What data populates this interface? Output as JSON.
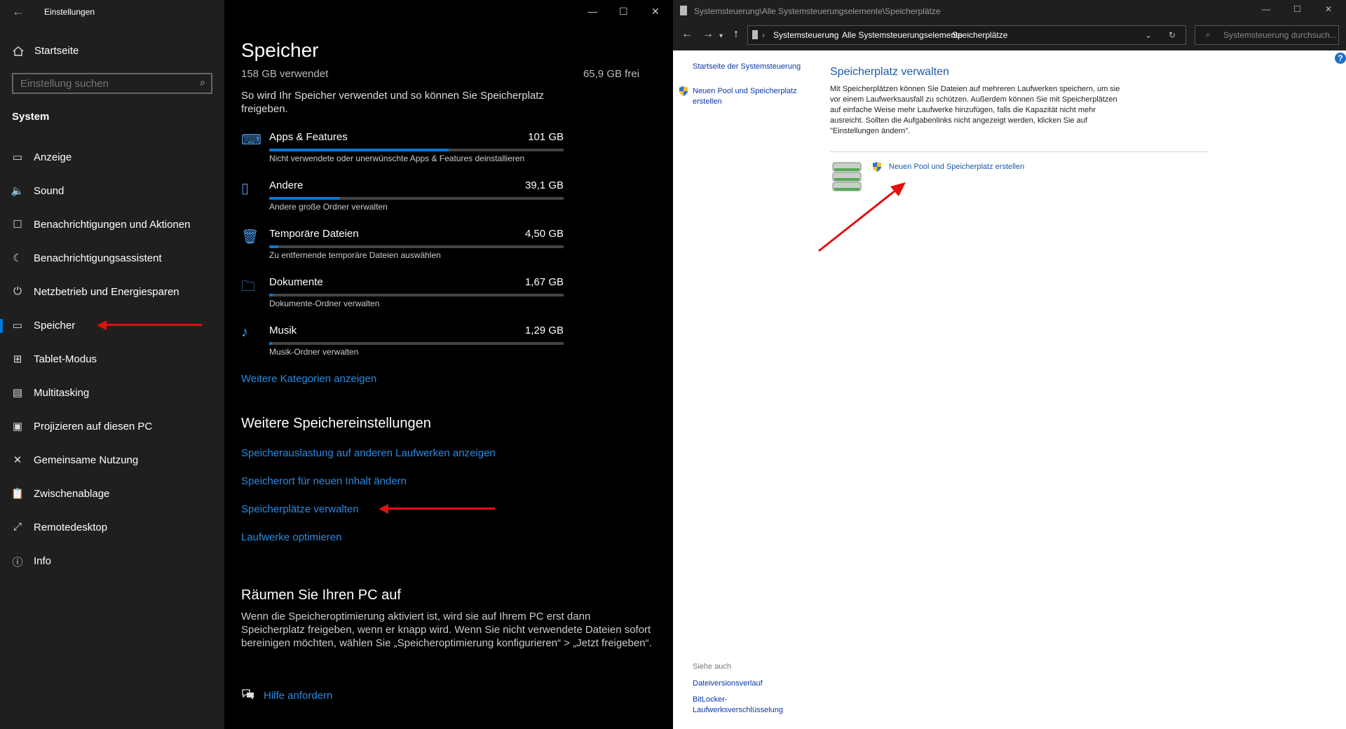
{
  "settings": {
    "window_title": "Einstellungen",
    "home_label": "Startseite",
    "search_placeholder": "Einstellung suchen",
    "section_label": "System",
    "nav_items": [
      {
        "label": "Anzeige",
        "icon": "monitor-icon"
      },
      {
        "label": "Sound",
        "icon": "speaker-icon"
      },
      {
        "label": "Benachrichtigungen und Aktionen",
        "icon": "notification-icon"
      },
      {
        "label": "Benachrichtigungsassistent",
        "icon": "moon-icon"
      },
      {
        "label": "Netzbetrieb und Energiesparen",
        "icon": "power-icon"
      },
      {
        "label": "Speicher",
        "icon": "storage-icon",
        "active": true
      },
      {
        "label": "Tablet-Modus",
        "icon": "tablet-icon"
      },
      {
        "label": "Multitasking",
        "icon": "multitasking-icon"
      },
      {
        "label": "Projizieren auf diesen PC",
        "icon": "project-icon"
      },
      {
        "label": "Gemeinsame Nutzung",
        "icon": "share-icon"
      },
      {
        "label": "Zwischenablage",
        "icon": "clipboard-icon"
      },
      {
        "label": "Remotedesktop",
        "icon": "remote-icon"
      },
      {
        "label": "Info",
        "icon": "info-icon"
      }
    ],
    "page_title": "Speicher",
    "used": "158 GB verwendet",
    "free": "65,9 GB frei",
    "intro": "So wird Ihr Speicher verwendet und so können Sie Speicherplatz freigeben.",
    "categories": [
      {
        "name": "Apps & Features",
        "size": "101 GB",
        "desc": "Nicht verwendete oder unerwünschte Apps & Features deinstallieren",
        "fill": 0.61,
        "icon": "apps-icon"
      },
      {
        "name": "Andere",
        "size": "39,1 GB",
        "desc": "Andere große Ordner verwalten",
        "fill": 0.24,
        "icon": "folder-other-icon"
      },
      {
        "name": "Temporäre Dateien",
        "size": "4,50 GB",
        "desc": "Zu entfernende temporäre Dateien auswählen",
        "fill": 0.03,
        "icon": "trash-icon"
      },
      {
        "name": "Dokumente",
        "size": "1,67 GB",
        "desc": "Dokumente-Ordner verwalten",
        "fill": 0.012,
        "icon": "documents-icon"
      },
      {
        "name": "Musik",
        "size": "1,29 GB",
        "desc": "Musik-Ordner verwalten",
        "fill": 0.01,
        "icon": "music-icon"
      }
    ],
    "more_categories": "Weitere Kategorien anzeigen",
    "more_settings_heading": "Weitere Speichereinstellungen",
    "more_links": [
      "Speicherauslastung auf anderen Laufwerken anzeigen",
      "Speicherort für neuen Inhalt ändern",
      "Speicherplätze verwalten",
      "Laufwerke optimieren"
    ],
    "cleanup_heading": "Räumen Sie Ihren PC auf",
    "cleanup_text": "Wenn die Speicheroptimierung aktiviert ist, wird sie auf Ihrem PC erst dann Speicherplatz freigeben, wenn er knapp wird. Wenn Sie nicht verwendete Dateien sofort bereinigen möchten, wählen Sie „Speicheroptimierung konfigurieren“ > „Jetzt freigeben“.",
    "help_link": "Hilfe anfordern"
  },
  "control_panel": {
    "window_title": "Systemsteuerung\\Alle Systemsteuerungselemente\\Speicherplätze",
    "breadcrumbs": [
      "Systemsteuerung",
      "Alle Systemsteuerungselemente",
      "Speicherplätze"
    ],
    "search_placeholder": "Systemsteuerung durchsuch...",
    "side_home": "Startseite der Systemsteuerung",
    "side_new_pool": "Neuen Pool und Speicherplatz erstellen",
    "heading": "Speicherplatz verwalten",
    "description": "Mit Speicherplätzen können Sie Dateien auf mehreren Laufwerken speichern, um sie vor einem Laufwerksausfall zu schützen. Außerdem können Sie mit Speicherplätzen auf einfache Weise mehr Laufwerke hinzufügen, falls die Kapazität nicht mehr ausreicht. Sollten die Aufgabenlinks nicht angezeigt werden, klicken Sie auf \"Einstellungen ändern\".",
    "action_link": "Neuen Pool und Speicherplatz erstellen",
    "see_also": "Siehe auch",
    "see_also_links": [
      "Dateiversionsverlauf",
      "BitLocker-Laufwerksverschlüsselung"
    ],
    "help_icon": "?"
  },
  "colors": {
    "accent": "#0078d7",
    "link_dark": "#2a8ae0",
    "cp_link": "#0b37a6",
    "cp_heading": "#1e5aa8",
    "annotation_arrow": "#e01010"
  }
}
